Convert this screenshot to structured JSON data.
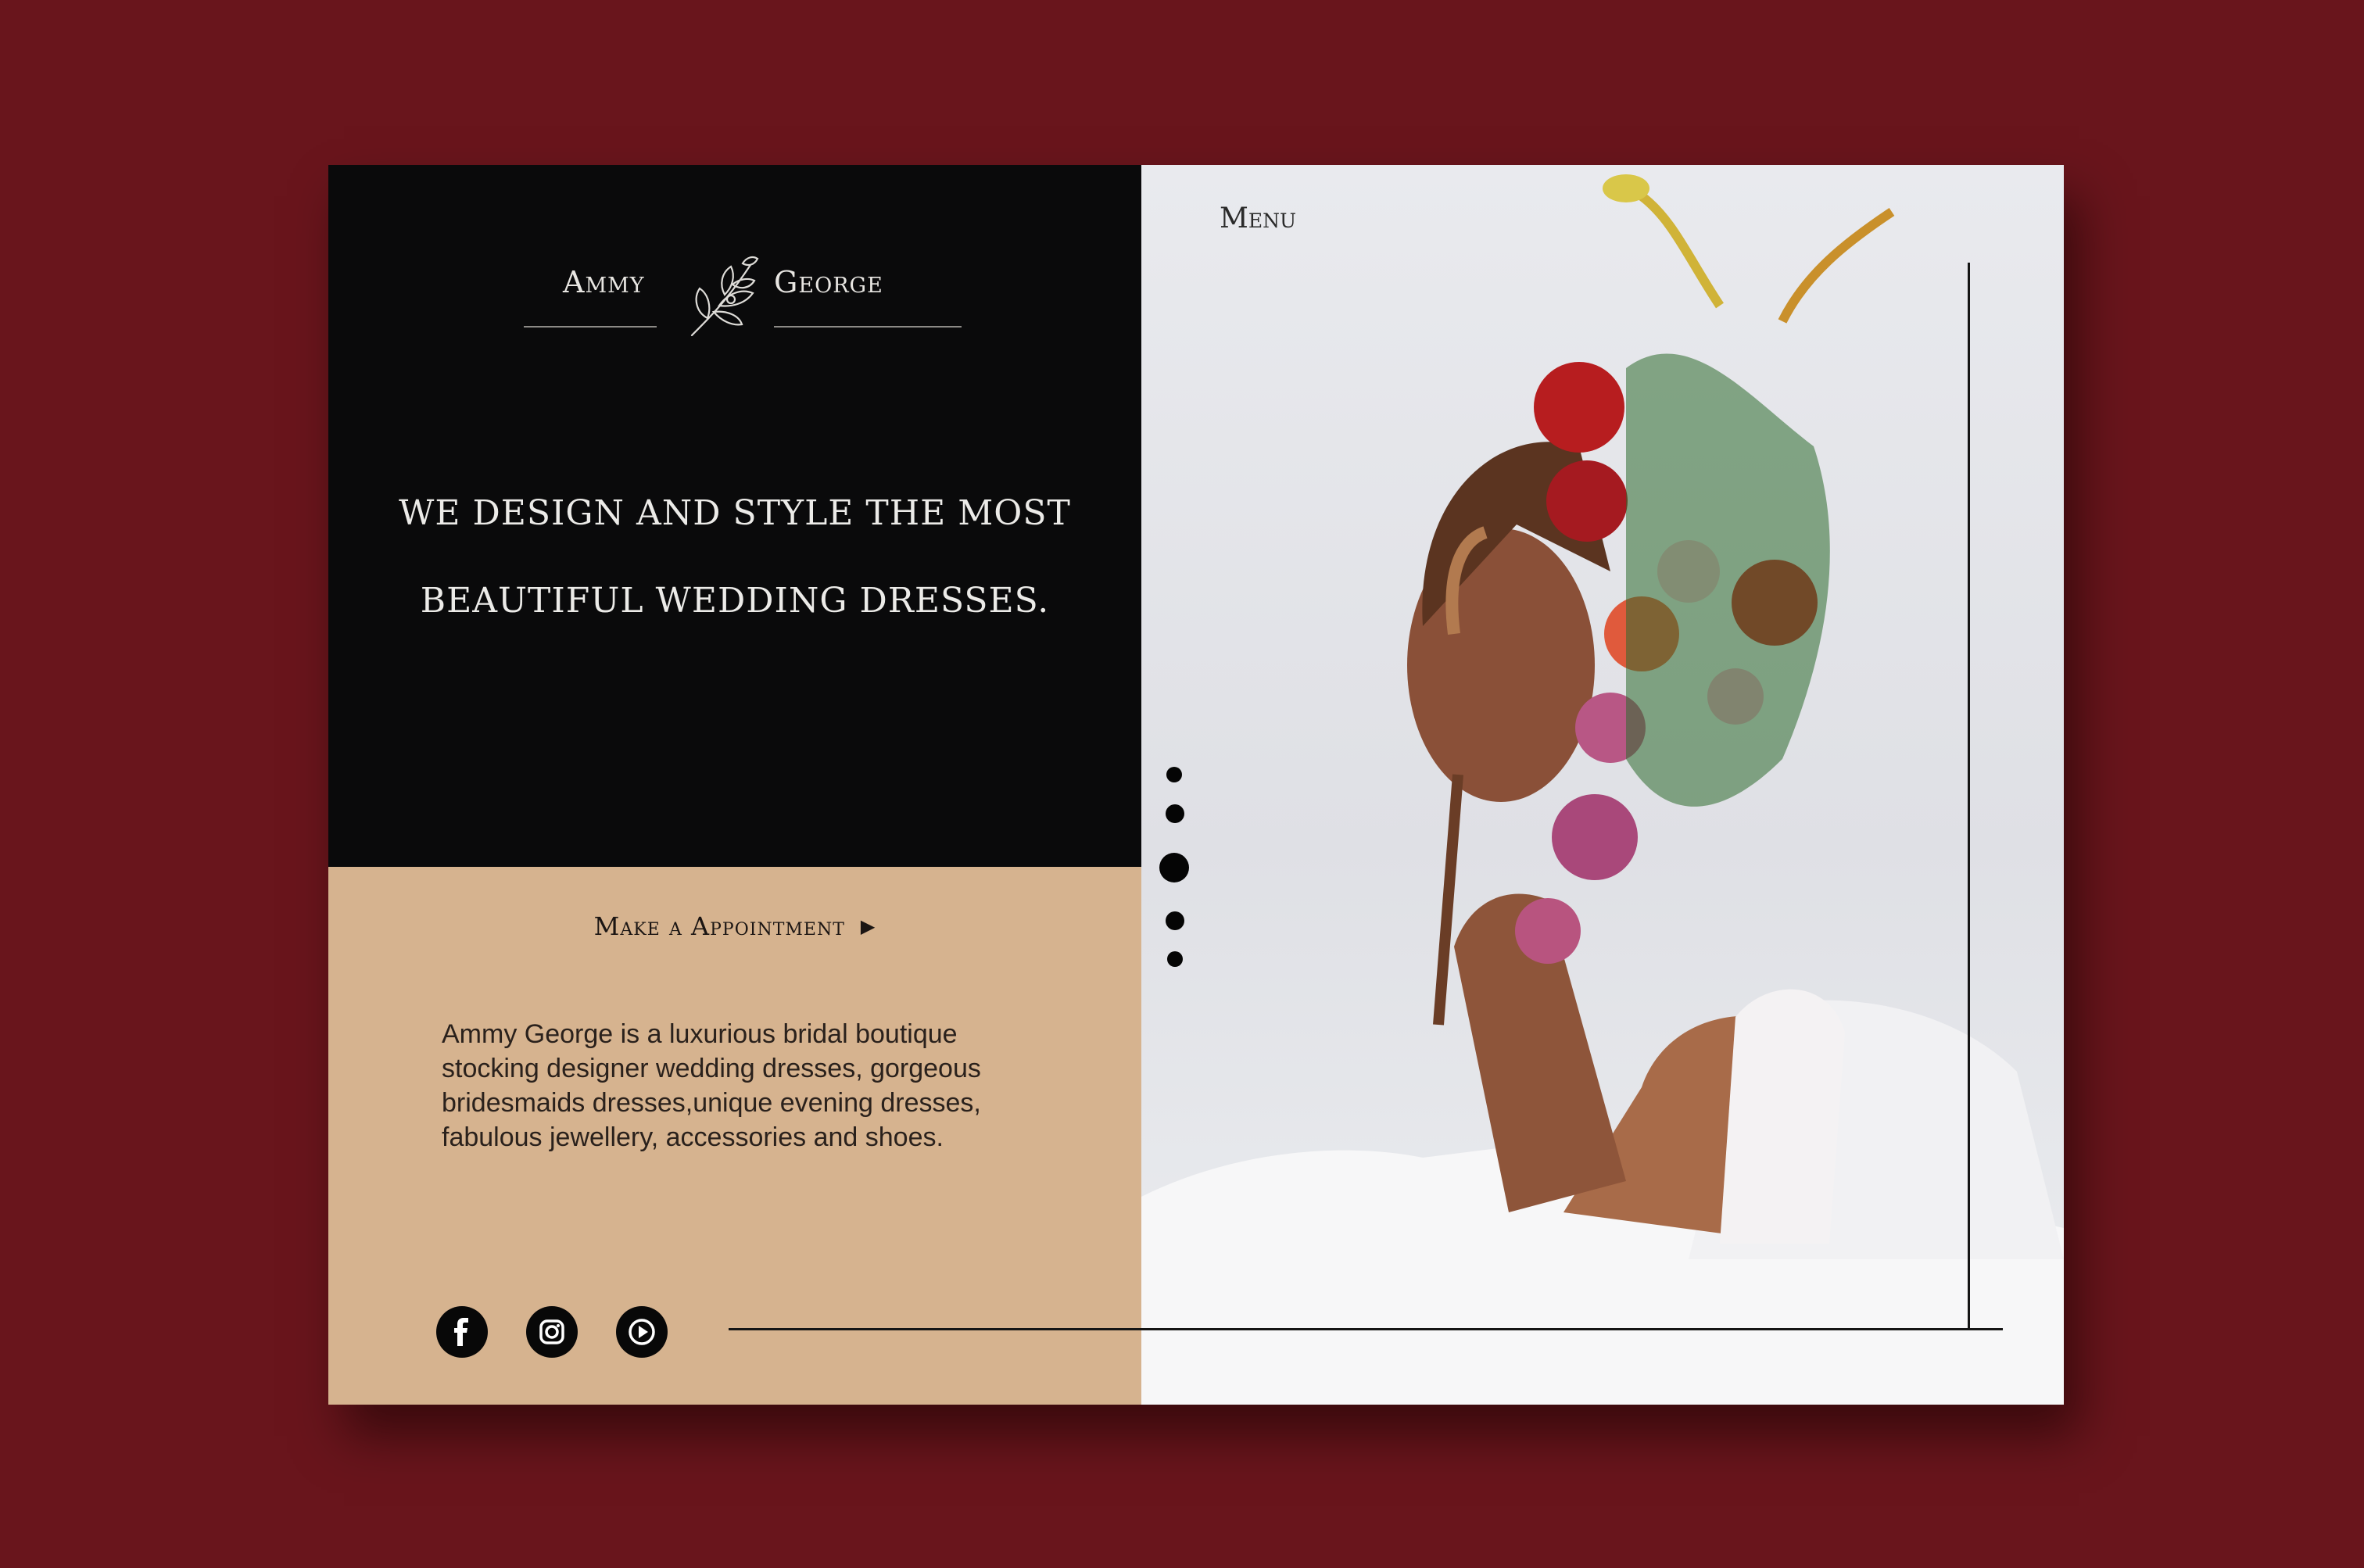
{
  "brand": {
    "name_left": "Ammy",
    "name_right": "George"
  },
  "hero": {
    "headline_line1": "WE DESIGN AND STYLE THE MOST",
    "headline_line2": "BEAUTIFUL WEDDING DRESSES."
  },
  "nav": {
    "menu_label": "Menu"
  },
  "cta": {
    "appointment_label": "Make a Appointment",
    "arrow": "▶"
  },
  "about": {
    "description": "Ammy George is a luxurious bridal boutique stocking designer wedding dresses, gorgeous bridesmaids dresses,unique evening dresses, fabulous jewellery, accessories and shoes."
  },
  "social": [
    {
      "icon": "facebook-icon"
    },
    {
      "icon": "instagram-icon"
    },
    {
      "icon": "youtube-play-icon"
    }
  ],
  "slider": {
    "count": 5,
    "active_index": 3
  },
  "colors": {
    "background": "#69151c",
    "panel_dark": "#0a0a0b",
    "panel_tan": "#d6b38f"
  }
}
